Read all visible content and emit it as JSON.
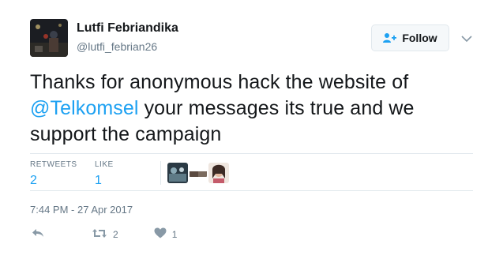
{
  "author": {
    "display_name": "Lutfi Febriandika",
    "handle": "@lutfi_febrian26"
  },
  "follow_button": {
    "label": "Follow",
    "icon": "person-add-icon"
  },
  "caret_icon": "chevron-down-icon",
  "tweet": {
    "text_before": "Thanks for anonymous hack the website of ",
    "mention": "@Telkomsel",
    "text_after": " your messages its true and we support the campaign"
  },
  "stats": {
    "retweets_label": "RETWEETS",
    "retweets_count": "2",
    "likes_label": "LIKE",
    "likes_count": "1"
  },
  "timestamp": "7:44 PM - 27 Apr 2017",
  "actions": {
    "reply_icon": "reply-icon",
    "retweet_icon": "retweet-icon",
    "retweet_count": "2",
    "like_icon": "heart-icon",
    "like_count": "1"
  },
  "colors": {
    "accent": "#1da1f2",
    "text": "#14171a",
    "muted": "#657786",
    "border": "#e1e8ed"
  }
}
